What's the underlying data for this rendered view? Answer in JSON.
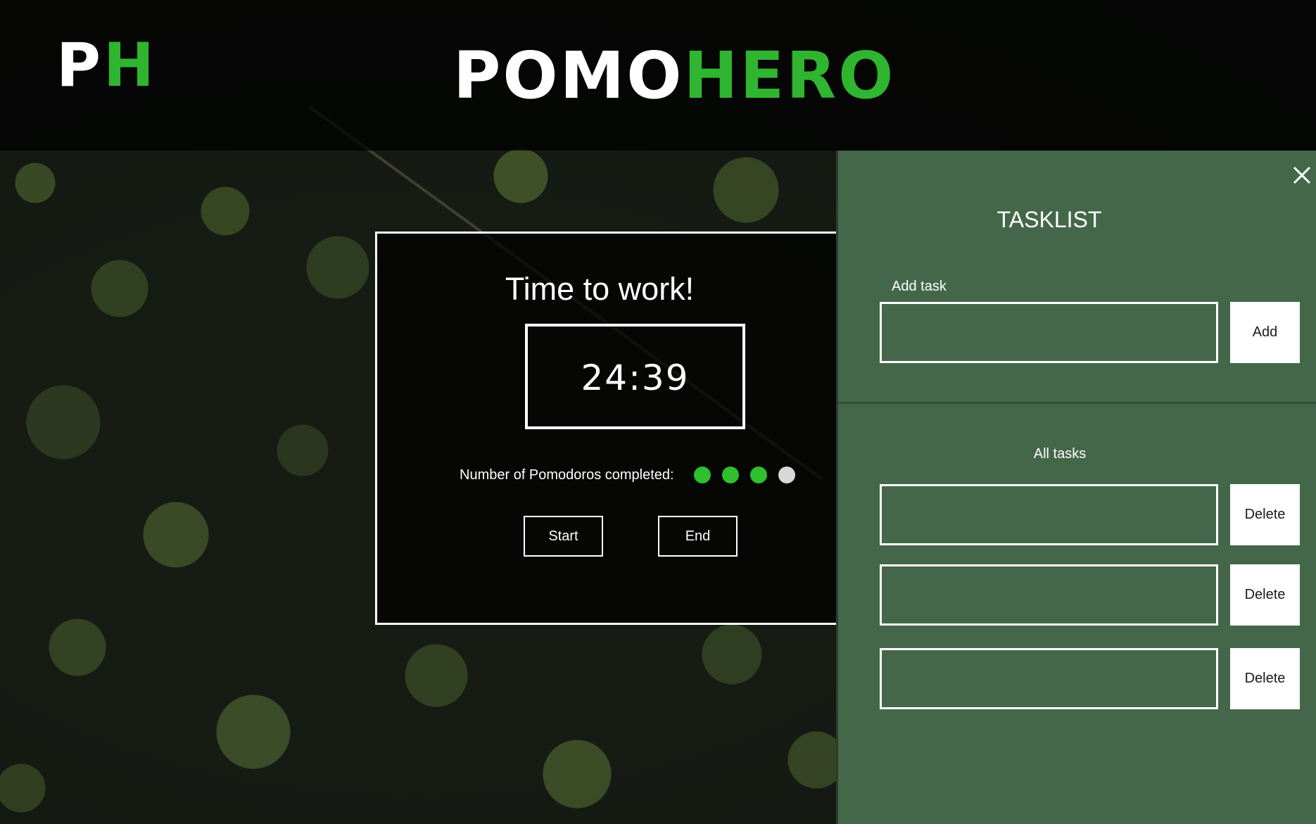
{
  "header": {
    "logo_first": "P",
    "logo_accent": "H",
    "brand_first": "POMO",
    "brand_accent": "HERO"
  },
  "timer": {
    "title": "Time to work!",
    "clock": "24:39",
    "pomodoros_label": "Number of Pomodoros completed:",
    "pomodoros_completed": 3,
    "pomodoros_total": 4,
    "start_label": "Start",
    "end_label": "End"
  },
  "tasklist": {
    "title": "TASKLIST",
    "add_label": "Add task",
    "add_value": "",
    "add_button": "Add",
    "all_label": "All tasks",
    "tasks": [
      {
        "value": "",
        "delete_label": "Delete"
      },
      {
        "value": "",
        "delete_label": "Delete"
      },
      {
        "value": "",
        "delete_label": "Delete"
      }
    ]
  },
  "colors": {
    "accent": "#2fb52f",
    "panel": "#44674a",
    "dot_done": "#2fbf2f",
    "dot_todo": "#d8d8d8"
  },
  "icons": {
    "close": "close-icon"
  }
}
